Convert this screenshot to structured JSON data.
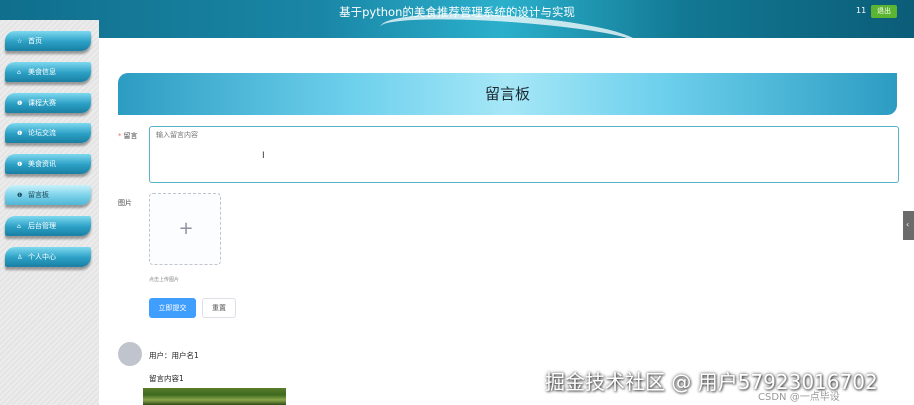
{
  "header": {
    "title": "基于python的美食推荐管理系统的设计与实现",
    "counter": "11",
    "logout_label": "退出"
  },
  "sidebar": {
    "items": [
      {
        "label": "首页",
        "icon": "star-icon",
        "glyph": "☆"
      },
      {
        "label": "美食信息",
        "icon": "bag-icon",
        "glyph": "⌂"
      },
      {
        "label": "课程大赛",
        "icon": "info-icon",
        "glyph": "❶"
      },
      {
        "label": "论坛交流",
        "icon": "info-icon",
        "glyph": "❶"
      },
      {
        "label": "美食资讯",
        "icon": "info-icon",
        "glyph": "❶"
      },
      {
        "label": "留言板",
        "icon": "info-icon",
        "glyph": "❶"
      },
      {
        "label": "后台管理",
        "icon": "home-icon",
        "glyph": "⌂"
      },
      {
        "label": "个人中心",
        "icon": "user-icon",
        "glyph": "♙"
      }
    ]
  },
  "main": {
    "title": "留言板",
    "form": {
      "content_label": "留言",
      "content_required": "*",
      "content_placeholder": "输入留言内容",
      "image_label": "图片",
      "upload_hint": "点击上传图片",
      "submit_label": "立即提交",
      "reset_label": "重置"
    },
    "messages": [
      {
        "user": "用户：用户名1",
        "content": "留言内容1"
      }
    ]
  },
  "overlay": {
    "watermark": "掘金技术社区 @ 用户5792301670​2",
    "csdn": "CSDN @一点毕设"
  },
  "colors": {
    "accent": "#409eff",
    "header": "#1a86a6",
    "logout": "#5cb531"
  }
}
